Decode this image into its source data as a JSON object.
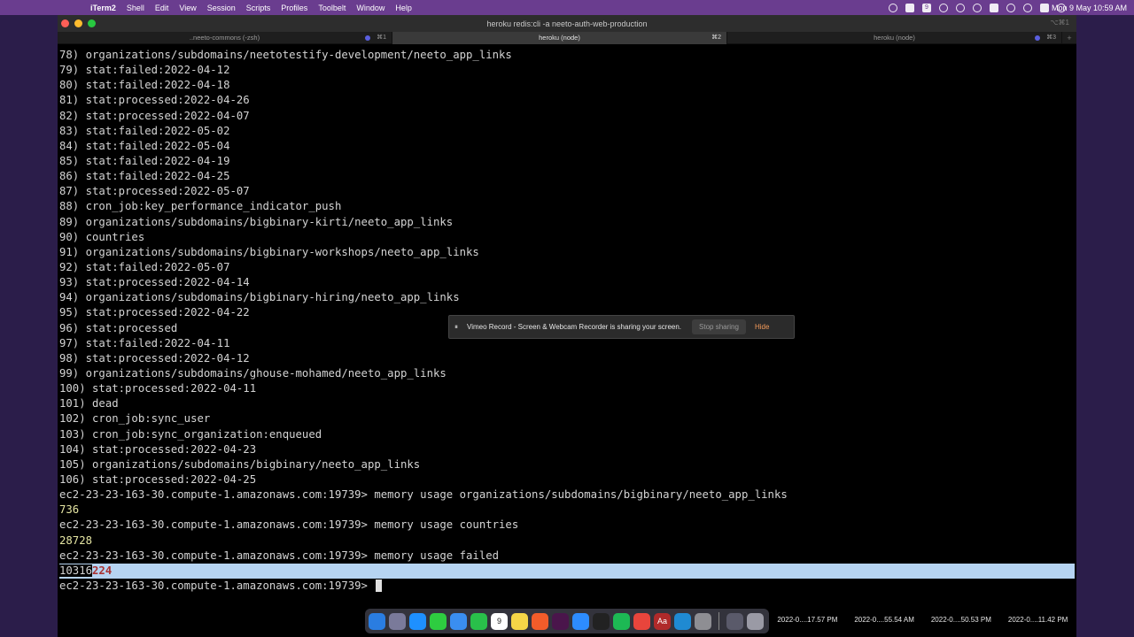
{
  "menubar": {
    "items": [
      "iTerm2",
      "Shell",
      "Edit",
      "View",
      "Session",
      "Scripts",
      "Profiles",
      "Toolbelt",
      "Window",
      "Help"
    ],
    "clock": "Mon 9 May  10:59 AM",
    "status_icons": [
      "mic-icon",
      "cast-icon",
      "badge-9-icon",
      "clock-icon",
      "bluetooth-icon",
      "play-icon",
      "battery-icon",
      "wifi-icon",
      "search-icon",
      "control-center-icon",
      "siri-icon"
    ]
  },
  "window": {
    "title": "heroku redis:cli -a neeto-auth-web-production",
    "shortcut": "⌥⌘1",
    "tabs": [
      {
        "label": "..neeto-commons (-zsh)",
        "shortcut": "⌘1",
        "active": false
      },
      {
        "label": "heroku (node)",
        "shortcut": "⌘2",
        "active": true
      },
      {
        "label": "heroku (node)",
        "shortcut": "⌘3",
        "active": false
      }
    ],
    "new_tab": "+"
  },
  "terminal": {
    "lines": [
      "78) organizations/subdomains/neetotestify-development/neeto_app_links",
      "79) stat:failed:2022-04-12",
      "80) stat:failed:2022-04-18",
      "81) stat:processed:2022-04-26",
      "82) stat:processed:2022-04-07",
      "83) stat:failed:2022-05-02",
      "84) stat:failed:2022-05-04",
      "85) stat:failed:2022-04-19",
      "86) stat:failed:2022-04-25",
      "87) stat:processed:2022-05-07",
      "88) cron_job:key_performance_indicator_push",
      "89) organizations/subdomains/bigbinary-kirti/neeto_app_links",
      "90) countries",
      "91) organizations/subdomains/bigbinary-workshops/neeto_app_links",
      "92) stat:failed:2022-05-07",
      "93) stat:processed:2022-04-14",
      "94) organizations/subdomains/bigbinary-hiring/neeto_app_links",
      "95) stat:processed:2022-04-22",
      "96) stat:processed",
      "97) stat:failed:2022-04-11",
      "98) stat:processed:2022-04-12",
      "99) organizations/subdomains/ghouse-mohamed/neeto_app_links",
      "100) stat:processed:2022-04-11",
      "101) dead",
      "102) cron_job:sync_user",
      "103) cron_job:sync_organization:enqueued",
      "104) stat:processed:2022-04-23",
      "105) organizations/subdomains/bigbinary/neeto_app_links",
      "106) stat:processed:2022-04-25",
      "ec2-23-23-163-30.compute-1.amazonaws.com:19739> memory usage organizations/subdomains/bigbinary/neeto_app_links",
      "736",
      "ec2-23-23-163-30.compute-1.amazonaws.com:19739> memory usage countries",
      "28728",
      "ec2-23-23-163-30.compute-1.amazonaws.com:19739> memory usage failed"
    ],
    "selected_prefix": "10316",
    "selected_suffix": "224",
    "prompt": "ec2-23-23-163-30.compute-1.amazonaws.com:19739> "
  },
  "share_banner": {
    "pause_glyph": "⏸",
    "message": "Vimeo Record - Screen & Webcam Recorder is sharing your screen.",
    "stop_label": "Stop sharing",
    "hide_label": "Hide"
  },
  "dock": {
    "apps": [
      {
        "name": "finder-icon",
        "color": "#2a7de1"
      },
      {
        "name": "launchpad-icon",
        "color": "#7a7a9a"
      },
      {
        "name": "safari-icon",
        "color": "#1e90ff"
      },
      {
        "name": "messages-icon",
        "color": "#2ecc40"
      },
      {
        "name": "mail-icon",
        "color": "#3a8ef0"
      },
      {
        "name": "facetime-icon",
        "color": "#29c04a"
      },
      {
        "name": "calendar-icon",
        "color": "#ffffff"
      },
      {
        "name": "notes-icon",
        "color": "#f5d547"
      },
      {
        "name": "brave-icon",
        "color": "#f25c2a"
      },
      {
        "name": "slack-icon",
        "color": "#4a154b"
      },
      {
        "name": "zoom-icon",
        "color": "#2d8cff"
      },
      {
        "name": "terminal-icon",
        "color": "#222222"
      },
      {
        "name": "spotify-icon",
        "color": "#1db954"
      },
      {
        "name": "chrome-icon",
        "color": "#e8453c"
      },
      {
        "name": "dictionary-icon",
        "color": "#b02a2a"
      },
      {
        "name": "vscode-icon",
        "color": "#1f8ad2"
      },
      {
        "name": "settings-icon",
        "color": "#8e8e93"
      },
      {
        "name": "downloads-icon",
        "color": "#5a5a6a"
      },
      {
        "name": "trash-icon",
        "color": "#9a9aa5"
      }
    ]
  },
  "desktop_files": [
    "2022-0....17.57 PM",
    "2022-0....55.54 AM",
    "2022-0....50.53 PM",
    "2022-0....11.42 PM"
  ]
}
